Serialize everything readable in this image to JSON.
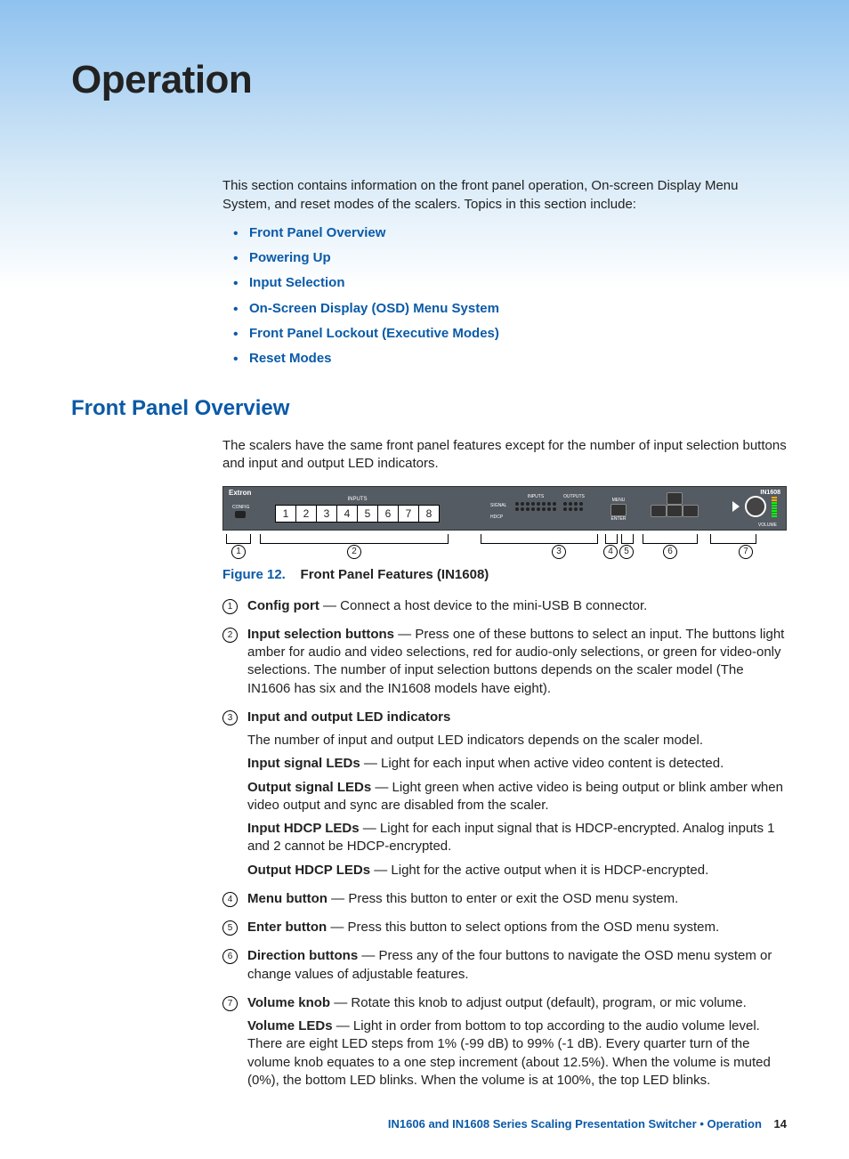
{
  "title": "Operation",
  "intro": "This section contains information on the front panel operation, On-screen Display Menu System, and reset modes of the scalers. Topics in this section include:",
  "links": [
    "Front Panel Overview",
    "Powering Up",
    "Input Selection",
    "On-Screen Display (OSD) Menu System",
    "Front Panel Lockout (Executive Modes)",
    "Reset Modes"
  ],
  "section_heading": "Front Panel Overview",
  "section_intro": "The scalers have the same front panel features except for the number of input selection buttons and input and output LED indicators.",
  "panel": {
    "brand": "Extron",
    "model": "IN1608",
    "config_label": "CONFIG",
    "inputs_label": "INPUTS",
    "buttons": [
      "1",
      "2",
      "3",
      "4",
      "5",
      "6",
      "7",
      "8"
    ],
    "led_inputs_label": "INPUTS",
    "led_outputs_label": "OUTPUTS",
    "signal_label": "SIGNAL",
    "hdcp_label": "HDCP",
    "menu_label": "MENU",
    "enter_label": "ENTER",
    "volume_label": "VOLUME"
  },
  "figure": {
    "num": "Figure 12.",
    "title": "Front Panel Features (IN1608)"
  },
  "callouts": [
    "1",
    "2",
    "3",
    "4",
    "5",
    "6",
    "7"
  ],
  "features": [
    {
      "num": "1",
      "title": "Config port",
      "body": " — Connect a host device to the mini-USB B connector."
    },
    {
      "num": "2",
      "title": "Input selection buttons",
      "body": " — Press one of these buttons to select an input. The buttons light amber for audio and video selections, red for audio-only selections, or green for video-only selections. The number of input selection buttons depends on the scaler model (The IN1606 has six and the IN1608 models have eight)."
    },
    {
      "num": "3",
      "title": "Input and output LED indicators",
      "body": "",
      "subs": [
        {
          "pre": "",
          "text": "The number of input and output LED indicators depends on the scaler model."
        },
        {
          "pre": "Input signal LEDs",
          "text": " — Light for each input when active video content is detected."
        },
        {
          "pre": "Output signal LEDs",
          "text": " — Light green when active video is being output or blink amber when video output and sync are disabled from the scaler."
        },
        {
          "pre": "Input HDCP LEDs",
          "text": " — Light for each input signal that is HDCP-encrypted. Analog inputs 1 and 2 cannot be HDCP-encrypted."
        },
        {
          "pre": "Output HDCP LEDs",
          "text": " — Light for the active output when it is HDCP-encrypted."
        }
      ]
    },
    {
      "num": "4",
      "title": "Menu button",
      "body": " — Press this button to enter or exit the OSD menu system."
    },
    {
      "num": "5",
      "title": "Enter button",
      "body": " — Press this button to select options from the OSD menu system."
    },
    {
      "num": "6",
      "title": "Direction buttons",
      "body": " — Press any of the four buttons to navigate the OSD menu system or change values of adjustable features."
    },
    {
      "num": "7",
      "title": "Volume knob",
      "body": " — Rotate this knob to adjust output (default), program, or mic volume.",
      "subs": [
        {
          "pre": "Volume LEDs",
          "text": " — Light in order from bottom to top according to the audio volume level. There are eight LED steps from 1% (-99 dB) to 99% (-1 dB). Every quarter turn of the volume knob equates to a one step increment (about 12.5%). When the volume is muted (0%), the bottom LED blinks. When the volume is at 100%, the top LED blinks."
        }
      ]
    }
  ],
  "footer": {
    "text": "IN1606 and IN1608 Series Scaling Presentation Switcher • Operation",
    "page": "14"
  }
}
